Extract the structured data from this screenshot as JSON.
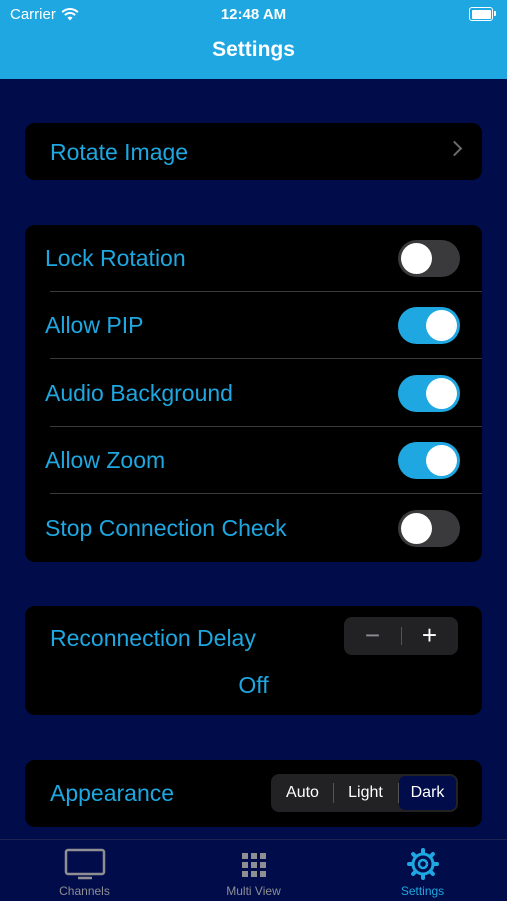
{
  "status_bar": {
    "carrier": "Carrier",
    "time": "12:48 AM"
  },
  "header": {
    "title": "Settings"
  },
  "rotate_card": {
    "label": "Rotate Image"
  },
  "toggles": [
    {
      "label": "Lock Rotation",
      "on": false
    },
    {
      "label": "Allow PIP",
      "on": true
    },
    {
      "label": "Audio Background",
      "on": true
    },
    {
      "label": "Allow Zoom",
      "on": true
    },
    {
      "label": "Stop Connection Check",
      "on": false
    }
  ],
  "reconnection": {
    "label": "Reconnection Delay",
    "minus": "−",
    "plus": "+",
    "value": "Off"
  },
  "appearance": {
    "label": "Appearance",
    "options": [
      "Auto",
      "Light",
      "Dark"
    ],
    "selected": "Dark"
  },
  "tabbar": {
    "tabs": [
      {
        "label": "Channels",
        "icon": "tv-icon",
        "active": false
      },
      {
        "label": "Multi View",
        "icon": "grid-icon",
        "active": false
      },
      {
        "label": "Settings",
        "icon": "gear-icon",
        "active": true
      }
    ]
  },
  "colors": {
    "accent": "#1ea7e0",
    "background": "#000d4a",
    "card": "#000000"
  }
}
